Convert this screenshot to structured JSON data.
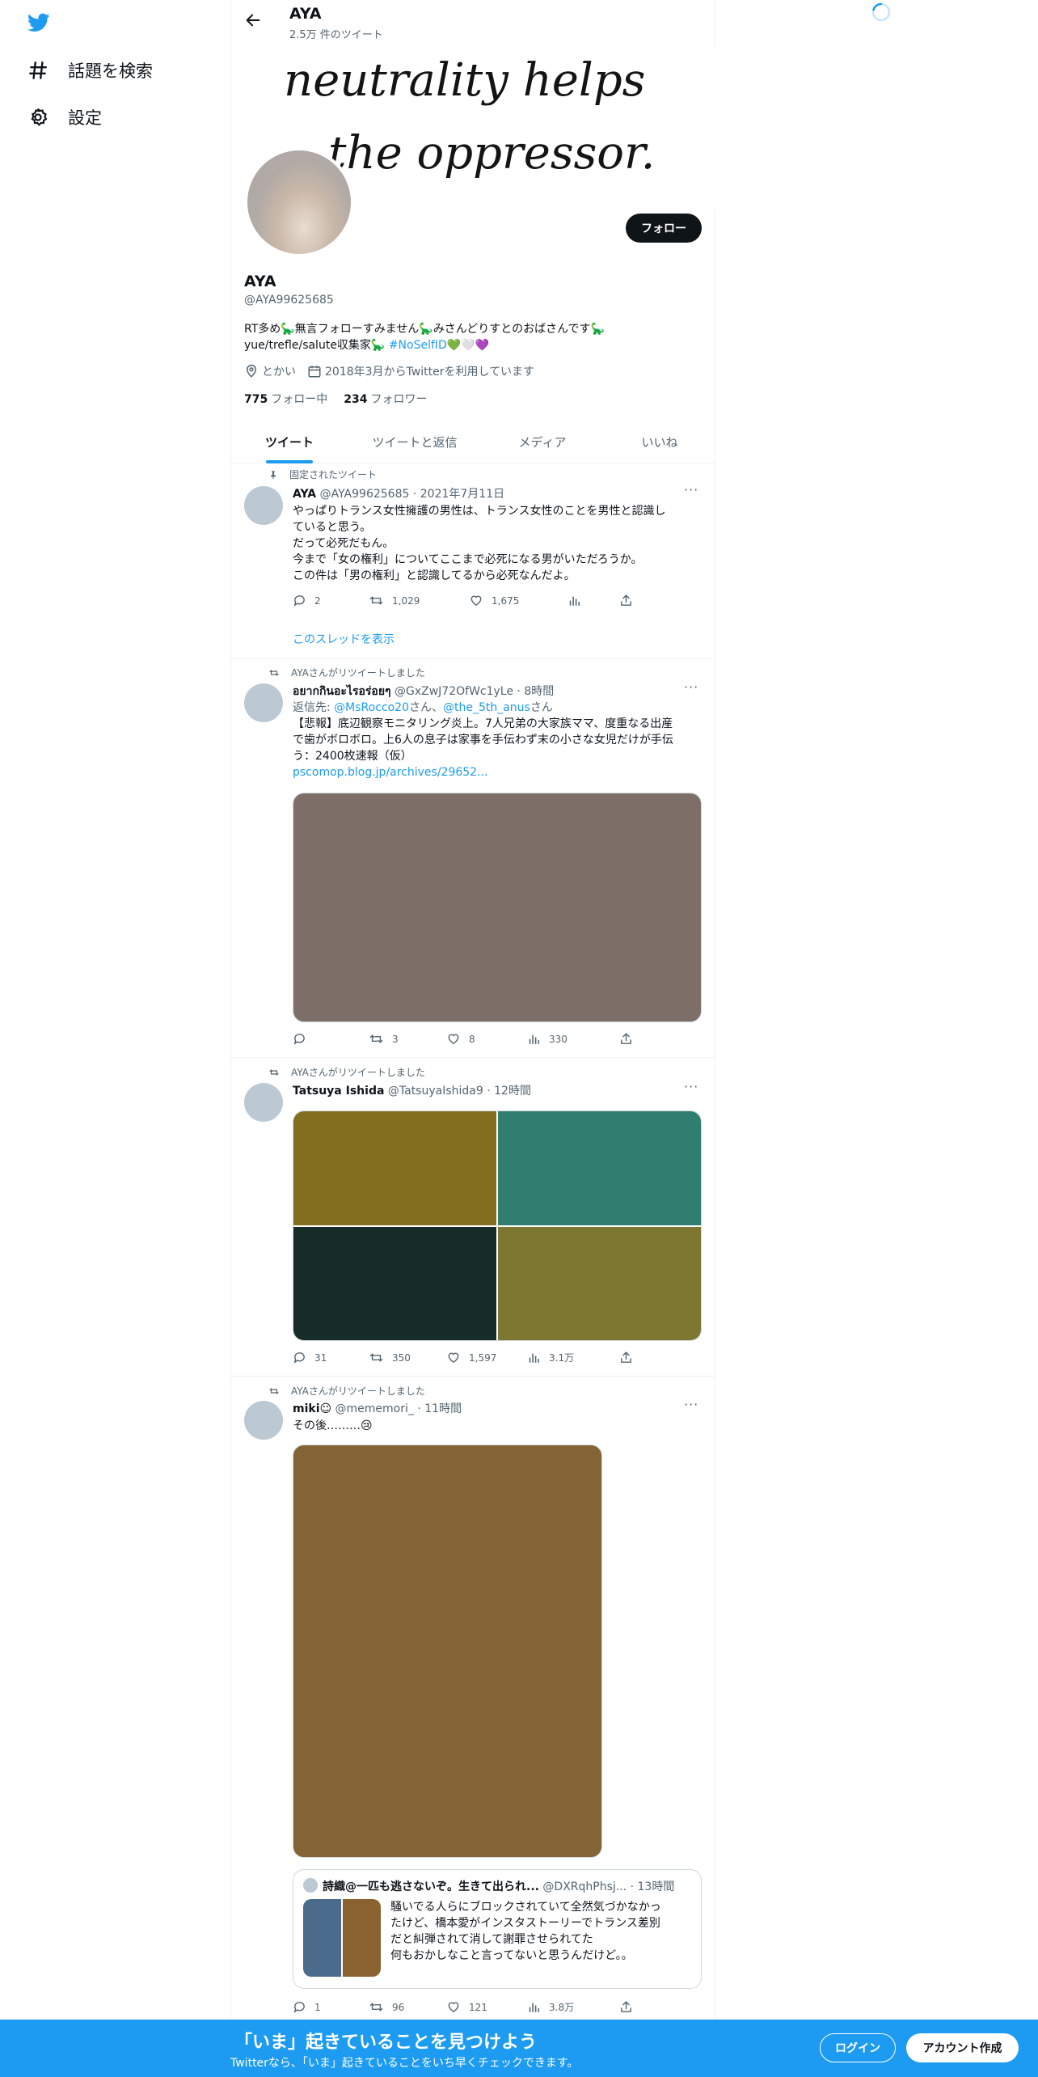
{
  "nav": {
    "explore_label": "話題を検索",
    "settings_label": "設定"
  },
  "header": {
    "title": "AYA",
    "subtitle": "2.5万 件のツイート"
  },
  "banner": {
    "line1": "neutrality helps",
    "line2": "the oppressor."
  },
  "profile": {
    "follow_label": "フォロー",
    "name": "AYA",
    "handle": "@AYA99625685",
    "bio_line1": "RT多め🦕無言フォローすみません🦕みさんどりすとのおばさんです🦕",
    "bio_line2_text": "yue/trefle/salute収集家🦕 ",
    "bio_hashtag": "#NoSelfID",
    "bio_line2_tail": "💚🤍💜",
    "location": "とかい",
    "joined": "2018年3月からTwitterを利用しています",
    "following_count": "775",
    "following_label": "フォロー中",
    "followers_count": "234",
    "followers_label": "フォロワー"
  },
  "tabs": [
    "ツイート",
    "ツイートと返信",
    "メディア",
    "いいね"
  ],
  "tweets": [
    {
      "context": "固定されたツイート",
      "name": "AYA",
      "handle": "@AYA99625685",
      "time": "2021年7月11日",
      "lines": [
        "やっぱりトランス女性擁護の男性は、トランス女性のことを男性と認識し",
        "ていると思う。",
        "だって必死だもん。",
        "今まで「女の権利」についてここまで必死になる男がいただろうか。",
        "この件は「男の権利」と認識してるから必死なんだよ。"
      ],
      "replies": "2",
      "retweets": "1,029",
      "likes": "1,675",
      "show_thread": "このスレッドを表示"
    },
    {
      "context": "AYAさんがリツイートしました",
      "name": "อยากกินอะไรอร่อยๆ",
      "handle": "@GxZwJ72OfWc1yLe",
      "time": "8時間",
      "reply_prefix": "返信先: ",
      "reply_to_1": "@MsRocco20",
      "reply_san_1": "さん、",
      "reply_to_2": "@the_5th_anus",
      "reply_san_2": "さん",
      "lines": [
        "【悲報】底辺観察モニタリング炎上。7人兄弟の大家族ママ、度重なる出産",
        "で歯がボロボロ。上6人の息子は家事を手伝わず末の小さな女児だけが手伝",
        "う：2400枚速報（仮）"
      ],
      "link": "pscomop.blog.jp/archives/29652...",
      "media_color": "#7e6e68",
      "replies": "",
      "retweets": "3",
      "likes": "8",
      "views": "330"
    },
    {
      "context": "AYAさんがリツイートしました",
      "name": "Tatsuya Ishida",
      "handle": "@TatsuyaIshida9",
      "time": "12時間",
      "media_colors": [
        "#846f1e",
        "#2f7e70",
        "#172c27",
        "#7e7732"
      ],
      "replies": "31",
      "retweets": "350",
      "likes": "1,597",
      "views": "3.1万"
    },
    {
      "context": "AYAさんがリツイートしました",
      "name": "miki☺",
      "handle": "@mememori_",
      "time": "11時間",
      "text": "その後………😢",
      "media_color": "#846334",
      "quote": {
        "name": "詩織@一匹も逃さないぞ。生きて出られ...",
        "handle": "@DXRqhPhsj...",
        "time": "13時間",
        "lines": [
          "騒いでる人らにブロックされていて全然気づかなかっ",
          "たけど、橋本愛がインスタストーリーでトランス差別",
          "だと糾弾されて消して謝罪させられてた",
          "何もおかしなこと言ってないと思うんだけど。。"
        ],
        "thumb_colors": [
          "#4a6b8c",
          "#8a6230"
        ]
      },
      "replies": "1",
      "retweets": "96",
      "likes": "121",
      "views": "3.8万"
    }
  ],
  "bottom_bar": {
    "title": "「いま」起きていることを見つけよう",
    "subtitle": "Twitterなら、「いま」起きていることをいち早くチェックできます。",
    "login_label": "ログイン",
    "signup_label": "アカウント作成"
  },
  "colors": {
    "brand_blue": "#1d9bf0",
    "text_primary": "#0f1419",
    "text_secondary": "#536471"
  }
}
